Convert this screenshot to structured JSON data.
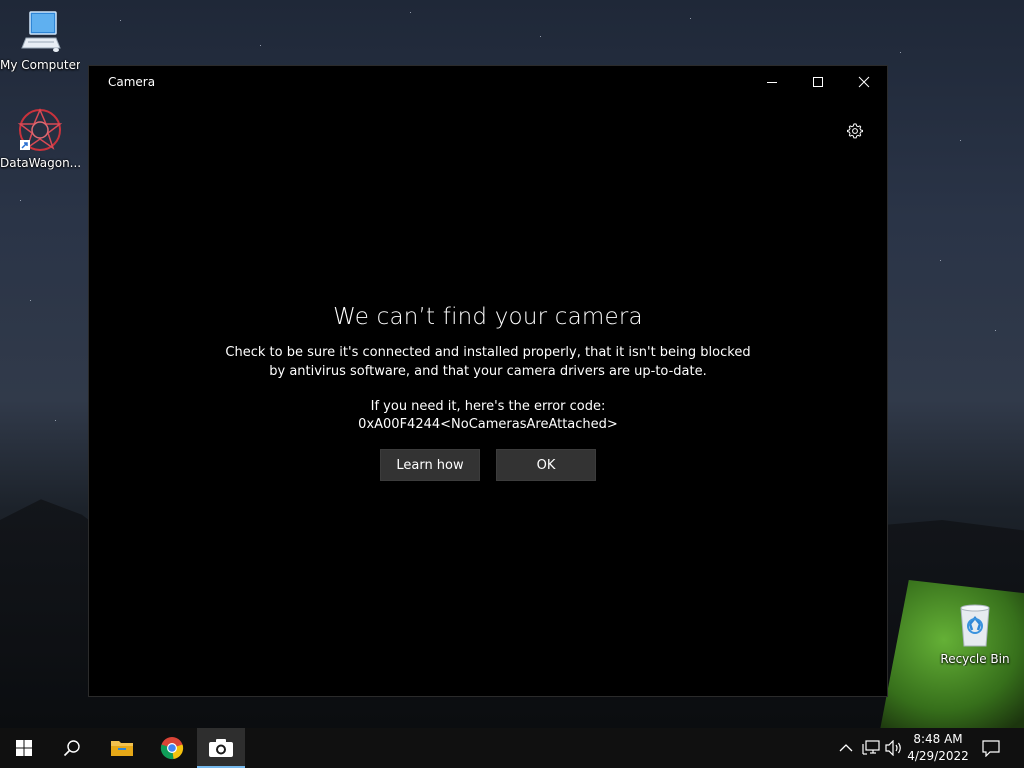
{
  "desktop": {
    "icons": [
      {
        "label": "My Computer",
        "icon": "computer-icon"
      },
      {
        "label": "DataWagon...",
        "icon": "datawagon-app-icon"
      },
      {
        "label": "Recycle Bin",
        "icon": "recycle-bin-icon"
      }
    ]
  },
  "window": {
    "title": "Camera",
    "controls": {
      "minimize": "minimize-icon",
      "maximize": "maximize-icon",
      "close": "close-icon"
    },
    "settings_icon": "gear-icon",
    "error": {
      "title": "We can’t find your camera",
      "body_line1": "Check to be sure it's connected and installed properly, that it isn't being blocked",
      "body_line2": "by antivirus software, and that your camera drivers are up-to-date.",
      "code_intro": "If you need it, here's the error code:",
      "code": "0xA00F4244<NoCamerasAreAttached>",
      "learn_how_label": "Learn how",
      "ok_label": "OK"
    }
  },
  "taskbar": {
    "items": [
      "windows-start-icon",
      "search-icon",
      "file-explorer-icon",
      "chrome-icon",
      "camera-app-icon"
    ],
    "active_item": "camera-app-icon",
    "tray": [
      "chevron-up-icon",
      "network-icon",
      "volume-icon"
    ],
    "time": "8:48 AM",
    "date": "4/29/2022",
    "notifications_icon": "action-center-icon"
  },
  "colors": {
    "window_bg": "#000000",
    "button_bg": "#333333",
    "taskbar_bg": "#101010",
    "accent": "#76b9ed"
  }
}
